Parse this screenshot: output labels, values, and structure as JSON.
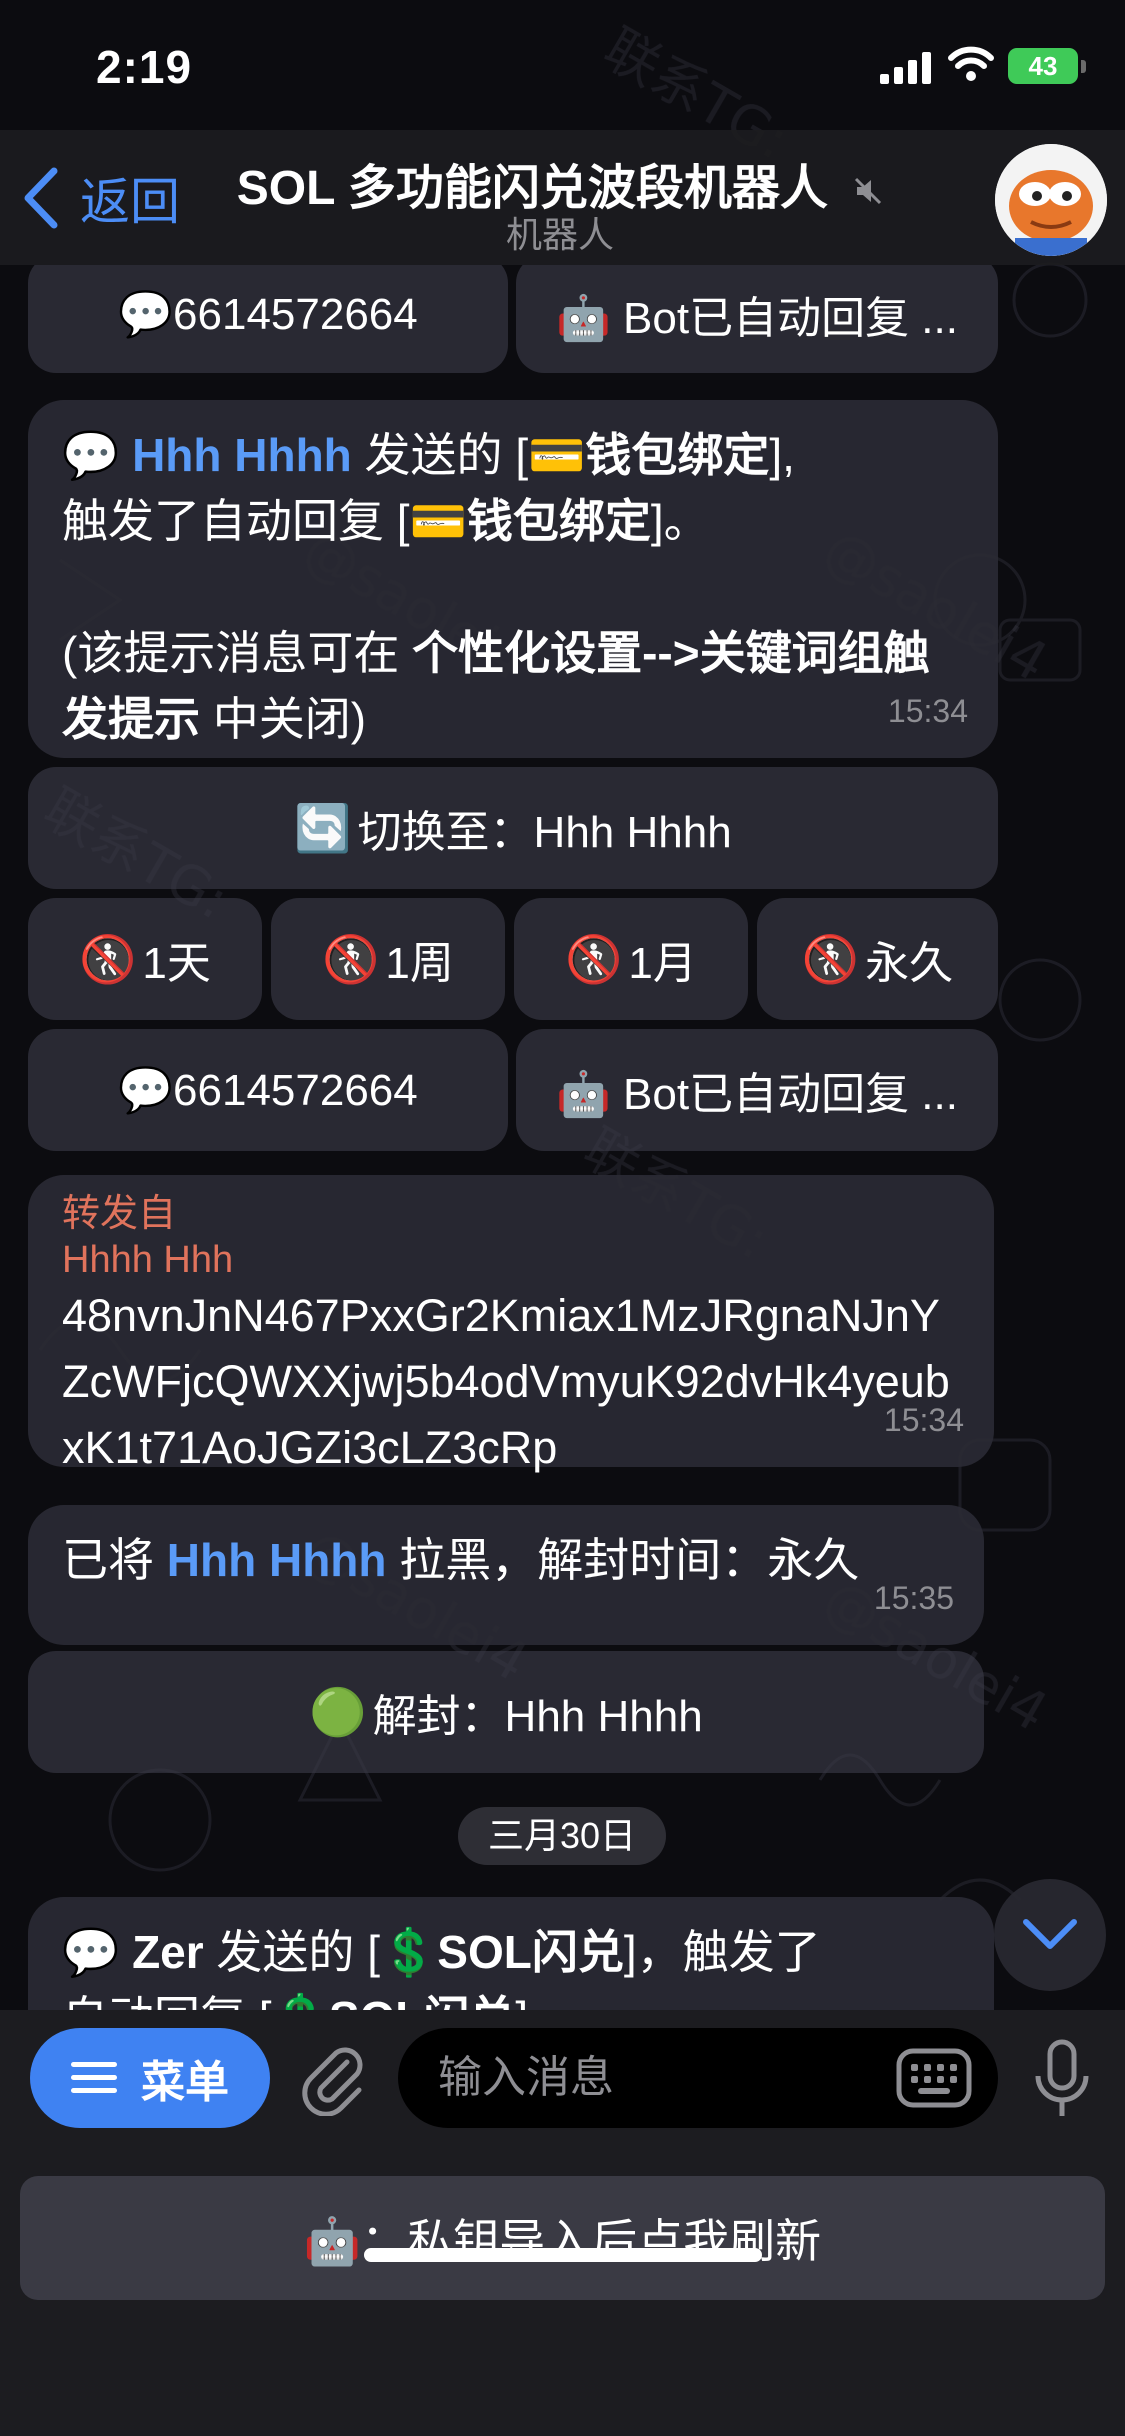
{
  "status_bar": {
    "time": "2:19",
    "battery": "43"
  },
  "nav": {
    "back_label": "返回",
    "title": "SOL 多功能闪兑波段机器人",
    "subtitle": "机器人"
  },
  "chat": {
    "kb_row_top": {
      "left": "💬6614572664",
      "right": "🤖 Bot已自动回复 ..."
    },
    "auto_reply_msg": {
      "sender": "Hhh Hhhh",
      "sent_text": " 发送的 [",
      "keyword": "钱包绑定",
      "triggered_text": "],\n触发了自动回复 [",
      "keyword2": "钱包绑定",
      "end_text": "]。",
      "note_prefix": "(该提示消息可在 ",
      "note_bold": "个性化设置-->关键词组触发提示",
      "note_suffix": " 中关闭)",
      "time": "15:34"
    },
    "switch_button": "切换至：Hhh Hhhh",
    "ban_buttons": [
      "1天",
      "1周",
      "1月",
      "永久"
    ],
    "kb_row_mid": {
      "left": "💬6614572664",
      "right": "🤖 Bot已自动回复 ..."
    },
    "forwarded": {
      "label": "转发自",
      "from": "Hhhh Hhh",
      "text": "48nvnJnN467PxxGr2Kmiax1MzJRgnaNJnYZcWFjcQWXXjwj5b4odVmyuK92dvHk4yeubxK1t71AoJGZi3cLZ3cRp",
      "time": "15:34"
    },
    "blocked_msg": {
      "prefix": "已将 ",
      "name": "Hhh Hhhh",
      "suffix": " 拉黑，解封时间：永久",
      "time": "15:35"
    },
    "unban_button": "解封：Hhh Hhhh",
    "date_divider": "三月30日",
    "last_msg": {
      "sender": "Zer",
      "text": " 发送的 [",
      "keyword": "SOL闪兑",
      "text2": "]，触发了",
      "line2": "自动回复 [",
      "keyword2": "SOL闪兑",
      "end": "]"
    }
  },
  "input_bar": {
    "menu_label": "菜单",
    "placeholder": "输入消息"
  },
  "reply_keyboard": {
    "button": "🤖：私钥导入后点我刷新"
  },
  "colors": {
    "accent": "#3f82f2",
    "link": "#5a9bf7",
    "forward": "#e0735c"
  }
}
